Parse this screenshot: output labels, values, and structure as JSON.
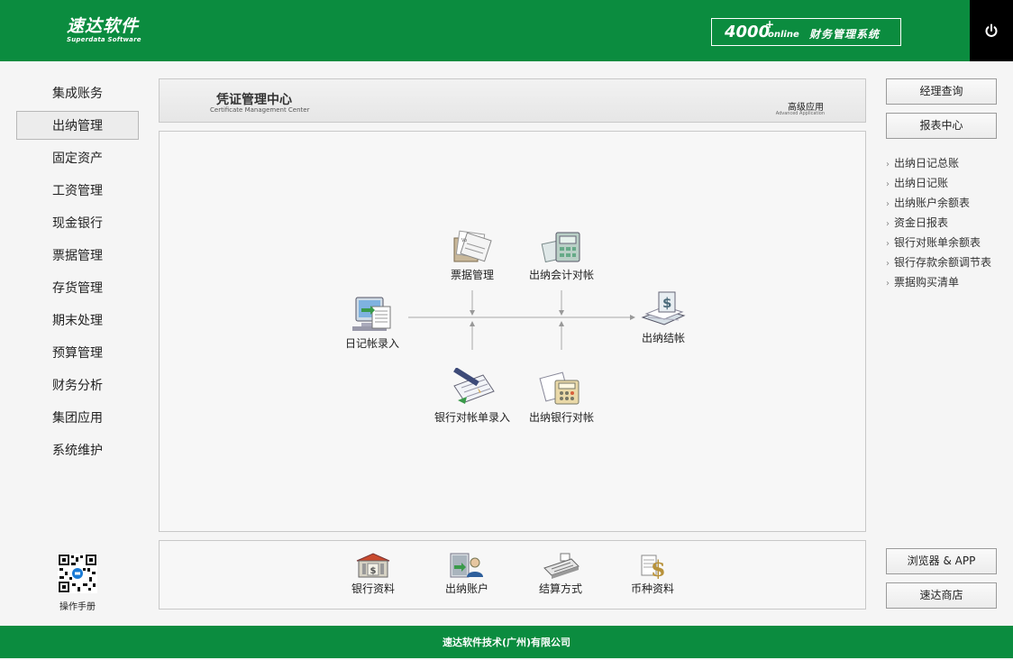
{
  "header": {
    "logo_cn": "速达软件",
    "logo_en": "Superdata Software",
    "product_number": "4000",
    "product_plus": "+",
    "product_online": "online",
    "product_name": "财务管理系统"
  },
  "left_nav": {
    "items": [
      {
        "label": "集成账务",
        "active": false
      },
      {
        "label": "出纳管理",
        "active": true
      },
      {
        "label": "固定资产",
        "active": false
      },
      {
        "label": "工资管理",
        "active": false
      },
      {
        "label": "现金银行",
        "active": false
      },
      {
        "label": "票据管理",
        "active": false
      },
      {
        "label": "存货管理",
        "active": false
      },
      {
        "label": "期末处理",
        "active": false
      },
      {
        "label": "预算管理",
        "active": false
      },
      {
        "label": "财务分析",
        "active": false
      },
      {
        "label": "集团应用",
        "active": false
      },
      {
        "label": "系统维护",
        "active": false
      }
    ],
    "manual_label": "操作手册"
  },
  "title_panel": {
    "title": "凭证管理中心",
    "subtitle": "Certificate Management Center",
    "advanced": "高级应用",
    "advanced_en": "Advanced Application"
  },
  "flow": {
    "nodes": {
      "journal_entry": "日记帐录入",
      "bill_management": "票据管理",
      "cashier_accounting_reconcile": "出纳会计对帐",
      "cashier_closing": "出纳结帐",
      "bank_statement_entry": "银行对帐单录入",
      "cashier_bank_reconcile": "出纳银行对帐"
    }
  },
  "bottom_panel": {
    "items": [
      "银行资料",
      "出纳账户",
      "结算方式",
      "币种资料"
    ]
  },
  "right_panel": {
    "manager_query": "经理查询",
    "report_center": "报表中心",
    "reports": [
      "出纳日记总账",
      "出纳日记账",
      "出纳账户余额表",
      "资金日报表",
      "银行对账单余额表",
      "银行存款余额调节表",
      "票据购买清单"
    ],
    "browser_app": "浏览器 & APP",
    "shop": "速达商店"
  },
  "footer": {
    "company": "速达软件技术(广州)有限公司"
  },
  "colors": {
    "brand_green": "#0b8c3f",
    "power_bg": "#000000"
  },
  "icons": [
    "power-icon",
    "qr-code-icon",
    "bill-icon",
    "calculator-check-icon",
    "monitor-icon",
    "money-book-icon",
    "pen-notebook-icon",
    "bank-calculator-icon",
    "bank-icon",
    "user-account-icon",
    "cash-register-icon",
    "currency-icon"
  ]
}
